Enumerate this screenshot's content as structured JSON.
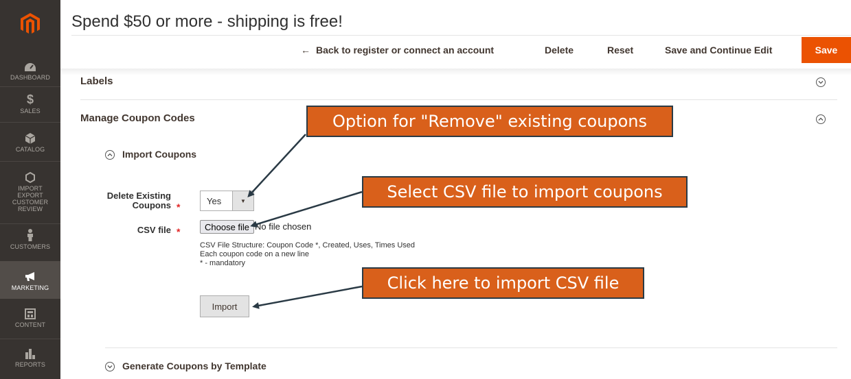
{
  "sidebar": {
    "logo": "magento-logo",
    "items": [
      {
        "label": "DASHBOARD",
        "icon": "dashboard-icon"
      },
      {
        "label": "SALES",
        "icon": "dollar-icon"
      },
      {
        "label": "CATALOG",
        "icon": "box-icon"
      },
      {
        "label": "IMPORT EXPORT CUSTOMER REVIEW",
        "icon": "hexagon-icon"
      },
      {
        "label": "CUSTOMERS",
        "icon": "person-icon"
      },
      {
        "label": "MARKETING",
        "icon": "megaphone-icon"
      },
      {
        "label": "CONTENT",
        "icon": "layout-icon"
      },
      {
        "label": "REPORTS",
        "icon": "bar-chart-icon"
      }
    ],
    "active": "MARKETING"
  },
  "header": {
    "title": "Spend $50 or more - shipping is free!",
    "back_label": "Back to register or connect an account",
    "delete_label": "Delete",
    "reset_label": "Reset",
    "save_continue_label": "Save and Continue Edit",
    "save_label": "Save",
    "accent_color": "#eb5202"
  },
  "sections": {
    "labels": "Labels",
    "manage_coupon_codes": "Manage Coupon Codes",
    "import_coupons": "Import Coupons",
    "generate_coupons": "Generate Coupons by Template"
  },
  "form": {
    "delete_existing_label_1": "Delete Existing",
    "delete_existing_label_2": "Coupons",
    "delete_existing_value": "Yes",
    "csv_file_label": "CSV file",
    "choose_file_label": "Choose file",
    "no_file_text": "No file chosen",
    "note_lines": [
      "CSV File Structure: Coupon Code *, Created, Uses, Times Used",
      "Each coupon code on a new line",
      "* - mandatory"
    ],
    "import_label": "Import",
    "required_mark": "*"
  },
  "callouts": {
    "remove": "Option for \"Remove\" existing coupons",
    "select_csv": "Select CSV file to import coupons",
    "import": "Click here to import CSV file"
  }
}
